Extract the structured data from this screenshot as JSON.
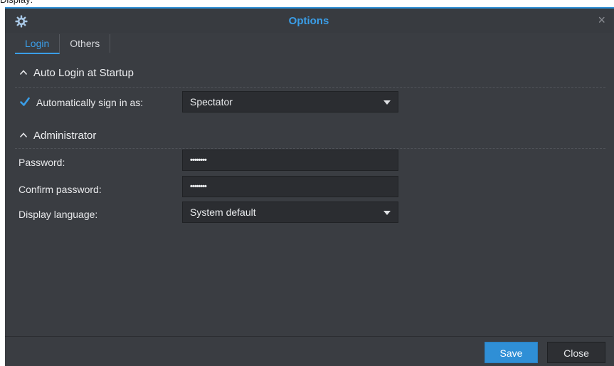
{
  "background_caption": "Display:",
  "window": {
    "title": "Options",
    "close_glyph": "×",
    "icons": {
      "title": "gear-icon",
      "close": "close-icon"
    }
  },
  "tabs": [
    {
      "label": "Login",
      "active": true
    },
    {
      "label": "Others",
      "active": false
    }
  ],
  "sections": {
    "auto_login": {
      "title": "Auto Login at Startup",
      "checkbox_label": "Automatically sign in as:",
      "checkbox_checked": true,
      "user_select": {
        "value": "Spectator"
      }
    },
    "administrator": {
      "title": "Administrator",
      "password_label": "Password:",
      "password_value": "••••••••",
      "confirm_label": "Confirm password:",
      "confirm_value": "••••••••",
      "language_label": "Display language:",
      "language_select": {
        "value": "System default"
      }
    }
  },
  "buttons": {
    "save": "Save",
    "close": "Close"
  },
  "colors": {
    "accent": "#2f8fd6",
    "title_text": "#3a9ee8",
    "dialog_bg": "#3a3d42",
    "field_bg": "#2b2d31"
  }
}
